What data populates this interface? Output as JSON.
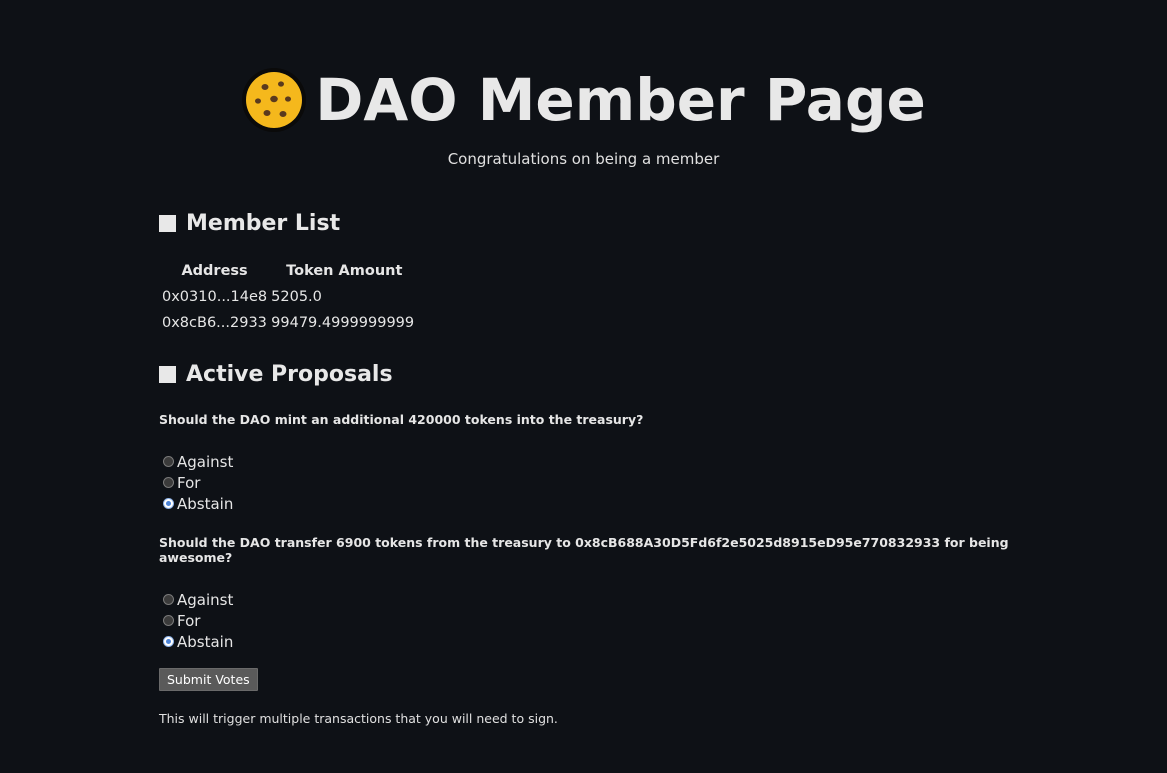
{
  "header": {
    "title": "DAO Member Page",
    "subtitle": "Congratulations on being a member",
    "logo_icon": "cookie-icon"
  },
  "members": {
    "heading": "Member List",
    "columns": [
      "Address",
      "Token Amount"
    ],
    "rows": [
      {
        "address": "0x0310...14e8",
        "amount": "5205.0"
      },
      {
        "address": "0x8cB6...2933",
        "amount": "99479.4999999999"
      }
    ]
  },
  "proposals": {
    "heading": "Active Proposals",
    "items": [
      {
        "question": "Should the DAO mint an additional 420000 tokens into the treasury?",
        "options": [
          "Against",
          "For",
          "Abstain"
        ],
        "selected": "Abstain"
      },
      {
        "question": "Should the DAO transfer 6900 tokens from the treasury to 0x8cB688A30D5Fd6f2e5025d8915eD95e770832933 for being awesome?",
        "options": [
          "Against",
          "For",
          "Abstain"
        ],
        "selected": "Abstain"
      }
    ],
    "submit_label": "Submit Votes",
    "note": "This will trigger multiple transactions that you will need to sign."
  },
  "colors": {
    "background": "#0e1116",
    "text": "#e6e6e6",
    "cookie": "#f5b81c"
  }
}
